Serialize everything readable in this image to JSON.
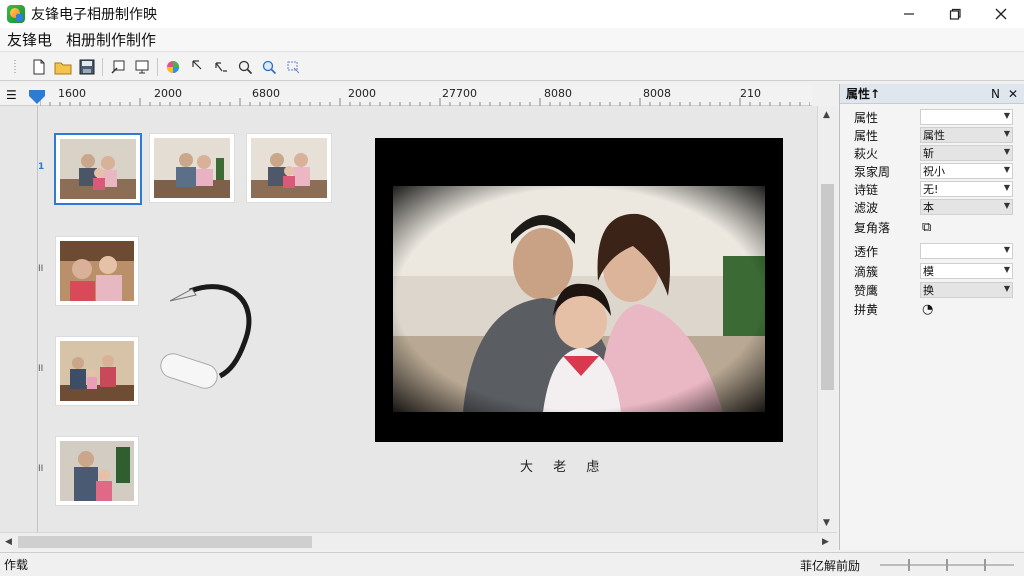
{
  "window": {
    "title": "友锋电子相册制作映",
    "controls": [
      "minimize-icon",
      "maximize-icon",
      "close-icon"
    ]
  },
  "menu": [
    "友锋电",
    "相册制作制作"
  ],
  "ruler": {
    "labels": [
      "1600",
      "2000",
      "6800",
      "2000",
      "27700",
      "8080",
      "8008",
      "210"
    ]
  },
  "timeline": {
    "row_markers": [
      "1",
      "II",
      "II",
      "II"
    ],
    "selected_index": 0
  },
  "preview": {
    "caption": "大 老 虑"
  },
  "properties": {
    "header": "属性↑",
    "header_buttons": [
      "N",
      "✕"
    ],
    "rows": [
      {
        "label": "属性",
        "value": "",
        "dropdown": true,
        "white": true
      },
      {
        "label": "属性",
        "value": "属性",
        "dropdown": true
      },
      {
        "label": "萩火",
        "value": "斩",
        "dropdown": true
      },
      {
        "label": "泵家周",
        "value": "祝小",
        "dropdown": true,
        "white": true
      },
      {
        "label": "诗链",
        "value": "无!",
        "dropdown": true,
        "white": true
      },
      {
        "label": "滤波",
        "value": "本",
        "dropdown": true
      },
      {
        "label": "复角落",
        "value": "",
        "dropdown": false
      },
      {
        "label": "透作",
        "value": "",
        "dropdown": true,
        "white": true
      },
      {
        "label": "滴簇",
        "value": "模",
        "dropdown": true,
        "white": true
      },
      {
        "label": "赞鹰",
        "value": "换",
        "dropdown": true
      },
      {
        "label": "拼黄",
        "value": "",
        "dropdown": false
      }
    ]
  },
  "status": {
    "left": "作载",
    "right": "菲亿解前励"
  },
  "colors": {
    "accent": "#2e7bd6",
    "panel_header": "#dfe6ee"
  }
}
